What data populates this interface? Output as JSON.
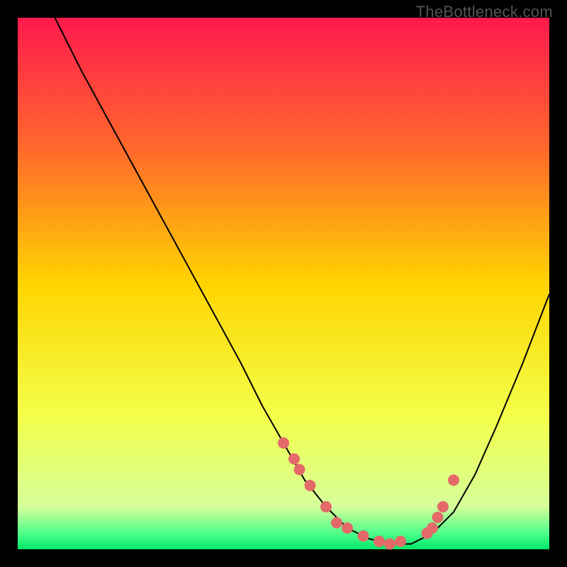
{
  "watermark": "TheBottleneck.com",
  "chart_data": {
    "type": "line",
    "title": "",
    "xlabel": "",
    "ylabel": "",
    "xlim": [
      0,
      100
    ],
    "ylim": [
      0,
      100
    ],
    "curve": {
      "x": [
        7,
        12,
        18,
        24,
        30,
        36,
        42,
        46,
        50,
        54,
        58,
        62,
        66,
        70,
        74,
        78,
        82,
        86,
        90,
        95,
        100
      ],
      "y": [
        100,
        90,
        79,
        68,
        57,
        46,
        35,
        27,
        20,
        13,
        8,
        4,
        2,
        1,
        1,
        3,
        7,
        14,
        23,
        35,
        48
      ]
    },
    "markers": {
      "x": [
        50,
        52,
        53,
        55,
        58,
        60,
        62,
        65,
        68,
        70,
        72,
        77,
        78,
        79,
        80,
        82
      ],
      "y": [
        20,
        17,
        15,
        12,
        8,
        5,
        4,
        2.5,
        1.5,
        1,
        1.5,
        3,
        4,
        6,
        8,
        13
      ]
    },
    "gradient_stops": [
      {
        "offset": 0.0,
        "color": "#ff1a4d"
      },
      {
        "offset": 0.25,
        "color": "#ff6a2a"
      },
      {
        "offset": 0.5,
        "color": "#ffd400"
      },
      {
        "offset": 0.75,
        "color": "#f3ff4a"
      },
      {
        "offset": 0.92,
        "color": "#d6ff9a"
      },
      {
        "offset": 0.97,
        "color": "#4eff8a"
      },
      {
        "offset": 1.0,
        "color": "#00e86a"
      }
    ],
    "marker_color": "#e46a6a",
    "line_color": "#000000"
  }
}
